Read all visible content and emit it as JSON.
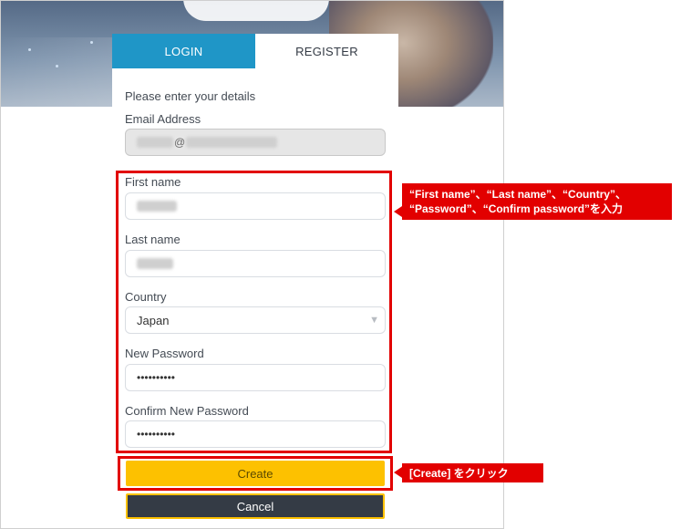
{
  "tabs": {
    "login": "LOGIN",
    "register": "REGISTER"
  },
  "form": {
    "prompt": "Please enter your details",
    "email_label": "Email Address",
    "email_value_sep": "@",
    "first_name_label": "First name",
    "last_name_label": "Last name",
    "country_label": "Country",
    "country_value": "Japan",
    "new_password_label": "New Password",
    "new_password_value": "••••••••••",
    "confirm_password_label": "Confirm New Password",
    "confirm_password_value": "••••••••••",
    "create_label": "Create",
    "cancel_label": "Cancel"
  },
  "annotations": {
    "fields_note_line1": "“First name”、“Last name”、“Country”、",
    "fields_note_line2": "“Password”、“Confirm  password”を入力",
    "create_note": "[Create] をクリック"
  },
  "colors": {
    "login_tab": "#1f96c7",
    "create_button": "#fdc100",
    "cancel_button": "#343b45",
    "highlight": "#e20000"
  }
}
